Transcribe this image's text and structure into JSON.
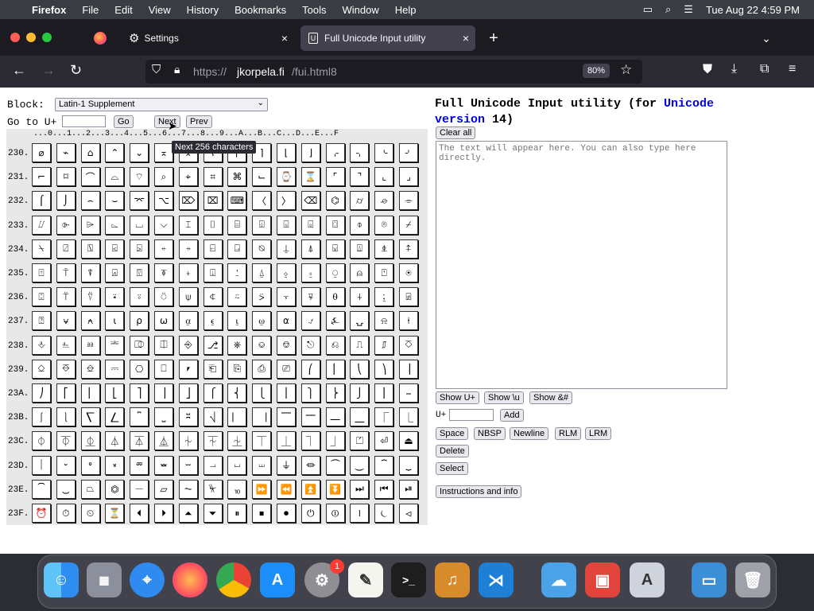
{
  "menubar": {
    "app": "Firefox",
    "items": [
      "File",
      "Edit",
      "View",
      "History",
      "Bookmarks",
      "Tools",
      "Window",
      "Help"
    ],
    "datetime": "Tue Aug 22  4:59 PM"
  },
  "tabs": [
    {
      "label": "Settings"
    },
    {
      "label": "Full Unicode Input utility"
    }
  ],
  "url": {
    "scheme": "https://",
    "host": "jkorpela.fi",
    "path": "/fui.html8"
  },
  "zoom": "80%",
  "page": {
    "block_label": "Block:",
    "block_value": "Latin-1 Supplement",
    "goto_label": "Go to U+",
    "go_button": "Go",
    "next_button": "Next",
    "prev_button": "Prev",
    "tooltip": "Next 256 characters",
    "header_row": "...0...1...2...3...4...5...6...7...8...9...A...B...C...D...E...F",
    "title_prefix": "Full Unicode Input utility (for ",
    "title_link1": "Unicode",
    "title_link2": "version",
    "title_suffix": " 14)",
    "clear_all": "Clear all",
    "textarea_placeholder": "The text will appear here. You can also type here directly.",
    "show_u": "Show U+",
    "show_slash_u": "Show \\u",
    "show_amp": "Show &#",
    "uplus_label": "U+",
    "add_button": "Add",
    "space_button": "Space",
    "nbsp_button": "NBSP",
    "newline_button": "Newline",
    "rlm_button": "RLM",
    "lrm_button": "LRM",
    "delete_button": "Delete",
    "select_button": "Select",
    "instructions_button": "Instructions and info",
    "rows": [
      {
        "label": "230.",
        "chars": "⌀⌁⌂⌃⌄⌅⌆⌇⌈⌉⌊⌋⌌⌍⌎⌏"
      },
      {
        "label": "231.",
        "chars": "⌐⌑⌒⌓⌔⌕⌖⌗⌘⌙⌚⌛⌜⌝⌞⌟"
      },
      {
        "label": "232.",
        "chars": "⌠⌡⌢⌣⌤⌥⌦⌧⌨〈〉⌫⌬⌭⌮⌯"
      },
      {
        "label": "233.",
        "chars": "⌰⌱⌲⌳⌴⌵⌶⌷⌸⌹⌺⌻⌼⌽⌾⌿"
      },
      {
        "label": "234.",
        "chars": "⍀⍁⍂⍃⍄⍅⍆⍇⍈⍉⍊⍋⍌⍍⍎⍏"
      },
      {
        "label": "235.",
        "chars": "⍐⍑⍒⍓⍔⍕⍖⍗⍘⍙⍚⍛⍜⍝⍞⍟"
      },
      {
        "label": "236.",
        "chars": "⍠⍡⍢⍣⍤⍥⍦⍧⍨⍩⍪⍫⍬⍭⍮⍯"
      },
      {
        "label": "237.",
        "chars": "⍰⍱⍲⍳⍴⍵⍶⍷⍸⍹⍺⍻⍼⍽⍾⍿"
      },
      {
        "label": "238.",
        "chars": "⎀⎁⎂⎃⎄⎅⎆⎇⎈⎉⎊⎋⎌⎍⎎⎏"
      },
      {
        "label": "239.",
        "chars": "⎐⎑⎒⎓⎔⎕⎖⎗⎘⎙⎚⎛⎜⎝⎞⎟"
      },
      {
        "label": "23A.",
        "chars": "⎠⎡⎢⎣⎤⎥⎦⎧⎨⎩⎪⎫⎬⎭⎮⎯"
      },
      {
        "label": "23B.",
        "chars": "⎰⎱⎲⎳⎴⎵⎶⎷⎸⎹⎺⎻⎼⎽⎾⎿"
      },
      {
        "label": "23C.",
        "chars": "⏀⏁⏂⏃⏄⏅⏆⏇⏈⏉⏊⏋⏌⏍⏎⏏"
      },
      {
        "label": "23D.",
        "chars": "⏐⏑⏒⏓⏔⏕⏖⏗⏘⏙⏚⏛⏜⏝⏞⏟"
      },
      {
        "label": "23E.",
        "chars": "⏠⏡⏢⏣⏤⏥⏦⏧⏨⏩⏪⏫⏬⏭⏮⏯"
      },
      {
        "label": "23F.",
        "chars": "⏰⏱⏲⏳⏴⏵⏶⏷⏸⏹⏺⏻⏼⏽⏾⏿"
      }
    ]
  },
  "dock": {
    "settings_badge": "1"
  }
}
